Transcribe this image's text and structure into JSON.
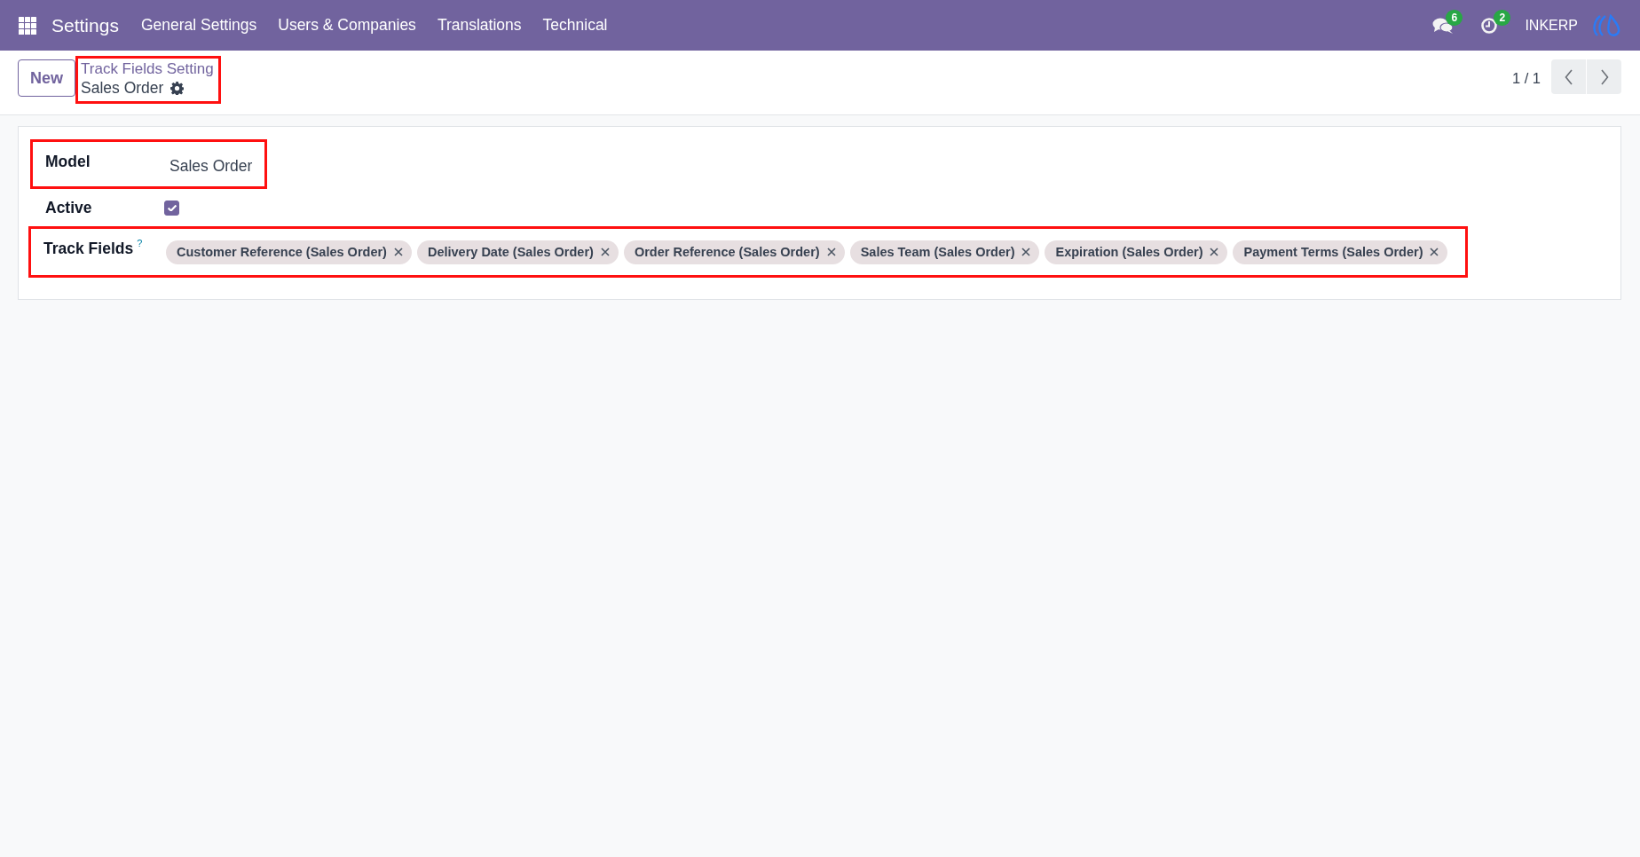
{
  "navbar": {
    "app_name": "Settings",
    "menu": [
      "General Settings",
      "Users & Companies",
      "Translations",
      "Technical"
    ],
    "messages_badge": "6",
    "activities_badge": "2",
    "company": "INKERP"
  },
  "control_panel": {
    "new_button": "New",
    "breadcrumb": {
      "parent": "Track Fields Setting",
      "current": "Sales Order",
      "highlighted": true
    },
    "pager": "1 / 1"
  },
  "form": {
    "fields": [
      {
        "kind": "text",
        "label": "Model",
        "value": "Sales Order",
        "highlighted": true
      },
      {
        "kind": "checkbox",
        "label": "Active",
        "checked": true,
        "highlighted": false
      },
      {
        "kind": "tags",
        "label": "Track Fields",
        "help": "?",
        "tags": [
          "Customer Reference (Sales Order)",
          "Delivery Date (Sales Order)",
          "Order Reference (Sales Order)",
          "Sales Team (Sales Order)",
          "Expiration (Sales Order)",
          "Payment Terms (Sales Order)"
        ],
        "highlighted": true
      }
    ]
  }
}
